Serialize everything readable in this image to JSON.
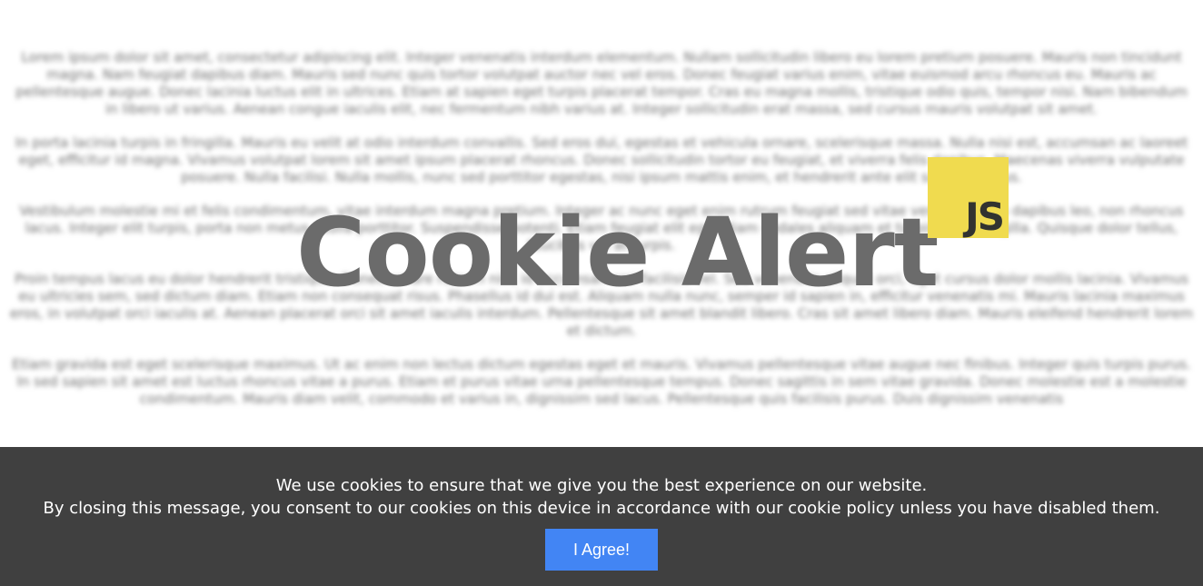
{
  "background": {
    "paragraphs": [
      "Lorem ipsum dolor sit amet, consectetur adipiscing elit. Integer venenatis interdum elementum. Nullam sollicitudin libero eu lorem pretium posuere. Mauris non tincidunt magna. Nam feugiat dapibus diam. Mauris sed nunc quis tortor volutpat auctor nec vel eros. Donec feugiat varius enim, vitae euismod arcu rhoncus eu. Mauris ac pellentesque augue. Donec lacinia luctus elit in ultrices. Etiam at sapien eget turpis placerat tempor. Cras eu magna mollis, tristique odio quis, tempor nisi. Nam bibendum in libero ut varius. Aenean congue iaculis elit, nec fermentum nibh varius at. Integer sollicitudin erat massa, sed cursus mauris volutpat sit amet.",
      "In porta lacinia turpis in fringilla. Mauris eu velit at odio interdum convallis. Sed eros dui, egestas et vehicula ornare, scelerisque massa. Nulla nisi est, accumsan ac laoreet eget, efficitur id magna. Vivamus volutpat lorem sit amet ipsum placerat rhoncus. Donec sollicitudin tortor eu feugiat, et viverra felis dapibus. Maecenas viverra vulputate posuere. Nulla facilisi. Nulla mollis, nunc sed porttitor egestas, nisi ipsum mattis enim, et hendrerit ante elit sagittis metus.",
      "Vestibulum molestie mi et felis condimentum, vitae interdum magna pretium. Integer ac nunc eget enim rutrum feugiat sed vitae vestibulum eu dapibus leo, non rhoncus lacus. Integer elit turpis, porta non metus. Nulla porttitor. Suspendisse potenti. Etiam feugiat elit eget diam sodales aliquam et turpis vitae fringilla. Quisque dolor tellus, faucibus vel at turpis.",
      "Proin tempus lacus eu dolor hendrerit tristique. Donec ornare rutrum nisi, id accumsan orci facilisis vel. Sed venenatis aliquet orci, eget cursus dolor mollis lacinia. Vivamus eu ultricies sem, sed dictum diam. Etiam non consequat risus. Phasellus id dui est. Aliquam nulla nunc, semper id sapien in, efficitur venenatis mi. Mauris lacinia maximus eros, in volutpat orci iaculis at. Aenean placerat orci sit amet iaculis interdum. Pellentesque sit amet blandit libero. Cras sit amet libero diam. Mauris eleifend hendrerit lorem et dictum.",
      "Etiam gravida est eget scelerisque maximus. Ut ac enim non lectus dictum egestas eget et mauris. Vivamus pellentesque vitae augue nec finibus. Integer quis turpis purus. In sed sapien sit amet est luctus rhoncus vitae a purus. Etiam et purus vitae urna pellentesque tempus. Donec sagittis in sem vitae gravida. Donec molestie est a molestie condimentum. Mauris diam velit, commodo et varius in, dignissim sed lacus. Pellentesque quis facilisis purus. Duis dignissim venenatis"
    ]
  },
  "hero": {
    "title": "Cookie Alert",
    "logo_text": "JS"
  },
  "cookie_banner": {
    "line1": "We use cookies to ensure that we give you the best experience on our website.",
    "line2": "By closing this message, you consent to our cookies on this device in accordance with our cookie policy unless you have disabled them.",
    "button_label": "I Agree!"
  },
  "colors": {
    "banner_bg": "#404040",
    "button_bg": "#4285f4",
    "logo_bg": "#f0db4f",
    "title_color": "#6b6b6b"
  }
}
